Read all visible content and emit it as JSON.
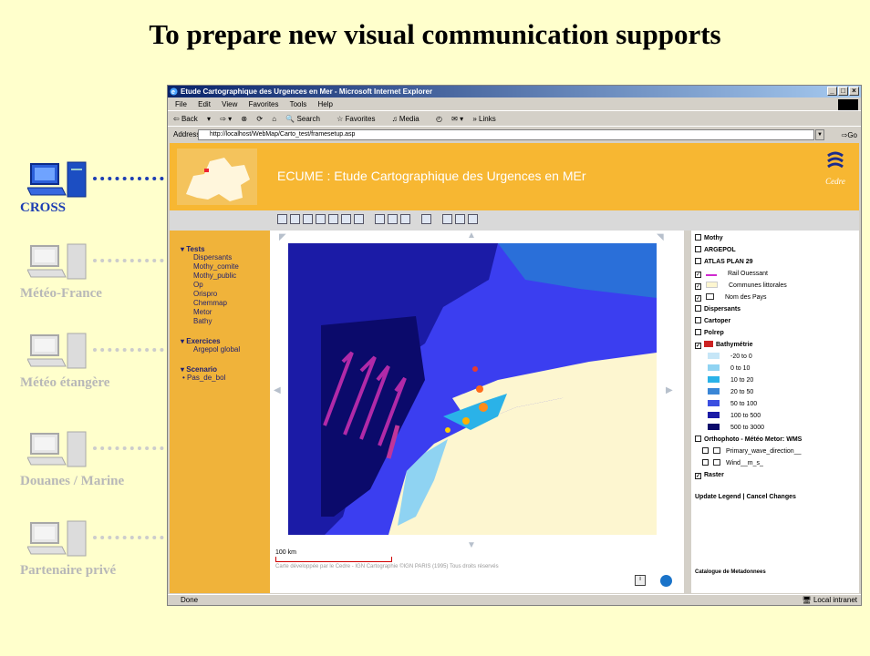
{
  "slide": {
    "title": "To prepare new visual communication supports",
    "clients": [
      {
        "name": "CROSS",
        "active": true
      },
      {
        "name": "Météo-France",
        "active": false
      },
      {
        "name": "Météo étangère",
        "active": false
      },
      {
        "name": "Douanes / Marine",
        "active": false
      },
      {
        "name": "Partenaire privé",
        "active": false
      }
    ]
  },
  "browser": {
    "title": "Etude Cartographique des Urgences en Mer - Microsoft Internet Explorer",
    "menu": [
      "File",
      "Edit",
      "View",
      "Favorites",
      "Tools",
      "Help"
    ],
    "toolbar": [
      "Back",
      "Search",
      "Favorites",
      "Media",
      "Links"
    ],
    "address_label": "Address",
    "address_value": "http://localhost/WebMap/Carto_test/framesetup.asp",
    "go_label": "Go",
    "status": "Done",
    "zone": "Local intranet"
  },
  "app": {
    "title": "ECUME : Etude Cartographique des Urgences en MEr",
    "logo_text": "Cedre"
  },
  "left_panel": {
    "groups": [
      {
        "label": "Tests",
        "items": [
          "Dispersants",
          "Mothy_comite",
          "Mothy_public",
          "Op",
          "Orispro",
          "Chemmap",
          "Metor",
          "Bathy"
        ]
      },
      {
        "label": "Exercices",
        "items": [
          "Argepol global"
        ]
      },
      {
        "label": "Scenario",
        "items": [
          "Pas_de_bol"
        ]
      }
    ]
  },
  "map": {
    "scale_label": "100 km",
    "credit": "Carte développée par le Cedre - IGN Cartographie ©IGN PARIS (1995) Tous droits réservés"
  },
  "legend": {
    "layers_top": [
      {
        "label": "Mothy",
        "checked": false,
        "bold": true
      },
      {
        "label": "ARGEPOL",
        "checked": false,
        "bold": true
      },
      {
        "label": "ATLAS PLAN 29",
        "checked": false,
        "bold": true
      },
      {
        "label": "Rail Ouessant",
        "checked": true,
        "bold": false
      },
      {
        "label": "Communes littorales",
        "checked": true,
        "bold": false
      },
      {
        "label": "Nom des Pays",
        "checked": true,
        "bold": false
      },
      {
        "label": "Dispersants",
        "checked": false,
        "bold": true
      },
      {
        "label": "Cartoper",
        "checked": false,
        "bold": true
      },
      {
        "label": "Polrep",
        "checked": false,
        "bold": true
      },
      {
        "label": "Bathymétrie",
        "checked": true,
        "bold": true
      }
    ],
    "bathy_classes": [
      {
        "label": "-20 to 0",
        "color": "#c6e6f7"
      },
      {
        "label": "0 to 10",
        "color": "#8fd3f2"
      },
      {
        "label": "10 to 20",
        "color": "#2ab2e8"
      },
      {
        "label": "20 to 50",
        "color": "#3a86d6"
      },
      {
        "label": "50 to 100",
        "color": "#3b4fe0"
      },
      {
        "label": "100 to 500",
        "color": "#1b1ba6"
      },
      {
        "label": "500 to 3000",
        "color": "#0b0a6b"
      }
    ],
    "layers_bottom": [
      {
        "label": "Orthophoto - Météo Metor: WMS",
        "checked": false,
        "bold": true
      },
      {
        "label": "Primary_wave_direction__",
        "checked": false,
        "bold": false
      },
      {
        "label": "Wind__m_s_",
        "checked": false,
        "bold": false
      },
      {
        "label": "Raster",
        "checked": true,
        "bold": true
      }
    ],
    "update_link": "Update Legend",
    "separator": "|",
    "cancel_link": "Cancel Changes",
    "bottom_label": "Catalogue de Metadonnees"
  },
  "colors": {
    "header": "#f7b732",
    "left_panel": "#f0b33a",
    "slide_bg": "#ffffcc",
    "cross_blue": "#1d3db3"
  }
}
